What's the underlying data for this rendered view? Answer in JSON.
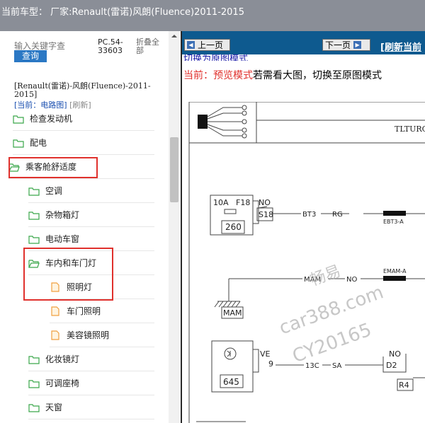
{
  "titlebar": {
    "text": "当前车型： 厂家:Renault(雷诺)风朗(Fluence)2011-2015"
  },
  "search": {
    "placeholder": "输入关键字查",
    "button": "查询"
  },
  "doc_code": "PC.54-33603",
  "collapse_label": "折叠全部",
  "breadcrumb": "[Renault(雷诺)-风朗(Fluence)-2011-2015]",
  "mode": {
    "current": "[当前：电路图]",
    "refresh": "[刷新]"
  },
  "tree": [
    {
      "label": "检查发动机",
      "icon": "folder-icon"
    },
    {
      "label": "配电",
      "icon": "folder-icon"
    },
    {
      "label": "乘客舱舒适度",
      "icon": "folder-open-icon"
    },
    {
      "label": "空调",
      "icon": "folder-icon"
    },
    {
      "label": "杂物箱灯",
      "icon": "folder-icon"
    },
    {
      "label": "电动车窗",
      "icon": "folder-icon"
    },
    {
      "label": "车内和车门灯",
      "icon": "folder-open-icon"
    },
    {
      "label": "照明灯",
      "icon": "document-icon"
    },
    {
      "label": "车门照明",
      "icon": "document-icon"
    },
    {
      "label": "美容镜照明",
      "icon": "document-icon"
    },
    {
      "label": "化妆镜灯",
      "icon": "folder-icon"
    },
    {
      "label": "可调座椅",
      "icon": "folder-icon"
    },
    {
      "label": "天窗",
      "icon": "folder-icon"
    }
  ],
  "nav": {
    "prev": "上一页",
    "next": "下一页",
    "refresh": "[刷新当前"
  },
  "switch_link": "切换为原图模式",
  "preview": {
    "label": "当前：预览模式",
    "text": "若需看大图，切换至原图模式"
  },
  "diagram": {
    "code": "TLTURQ/HS",
    "fuse_rating": "10A",
    "fuse_id": "F18",
    "no": "NO",
    "s18": "S18",
    "bt3": "BT3",
    "rg": "RG",
    "ebt3a": "EBT3-A",
    "box260": "260",
    "emama": "EMAM-A",
    "mam": "MAM",
    "mam_box": "MAM",
    "ve": "VE",
    "pin9": "9",
    "c13": "13C",
    "sa": "SA",
    "no2": "NO",
    "d2": "D2",
    "r4": "R4",
    "box645": "645",
    "watermark1": "畅易",
    "watermark2": "car388.com",
    "watermark3": "CY20165"
  },
  "colors": {
    "accent": "#0e5a8f",
    "highlight": "#e0312d",
    "button": "#2b78c4"
  }
}
